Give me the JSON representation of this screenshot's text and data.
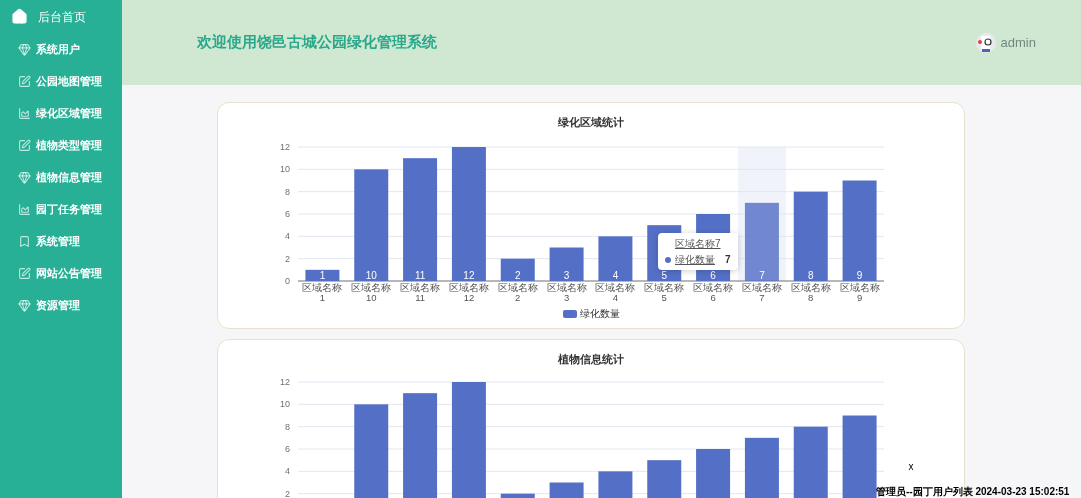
{
  "sidebar": {
    "home": "后台首页",
    "items": [
      {
        "label": "系统用户",
        "kind": "gem"
      },
      {
        "label": "公园地图管理",
        "kind": "edit"
      },
      {
        "label": "绿化区域管理",
        "kind": "chart"
      },
      {
        "label": "植物类型管理",
        "kind": "edit"
      },
      {
        "label": "植物信息管理",
        "kind": "gem"
      },
      {
        "label": "园丁任务管理",
        "kind": "chart"
      },
      {
        "label": "系统管理",
        "kind": "bookmark"
      },
      {
        "label": "网站公告管理",
        "kind": "edit"
      },
      {
        "label": "资源管理",
        "kind": "gem"
      }
    ]
  },
  "header": {
    "title": "欢迎使用饶邑古城公园绿化管理系统",
    "user": "admin"
  },
  "charts": [
    {
      "chart_data": {
        "type": "bar",
        "title": "绿化区域统计",
        "categories": [
          "区域名称 1",
          "区域名称 10",
          "区域名称 11",
          "区域名称 12",
          "区域名称 2",
          "区域名称 3",
          "区域名称 4",
          "区域名称 5",
          "区域名称 6",
          "区域名称 7",
          "区域名称 8",
          "区域名称 9"
        ],
        "series": [
          {
            "name": "绿化数量",
            "color": "#5470c6",
            "values": [
              1,
              10,
              11,
              12,
              2,
              3,
              4,
              5,
              6,
              7,
              8,
              9
            ]
          }
        ],
        "yticks": [
          0,
          2,
          4,
          6,
          8,
          10,
          12
        ],
        "ylim": [
          0,
          12
        ],
        "grid": true,
        "data_labels": true
      },
      "hover": [
        false,
        false,
        false,
        false,
        false,
        false,
        false,
        false,
        false,
        true,
        false,
        false
      ],
      "tooltip": {
        "title": "区域名称7",
        "series": "绿化数量",
        "value": "7"
      }
    },
    {
      "chart_data": {
        "type": "bar",
        "title": "植物信息统计",
        "series": [
          {
            "color": "#5470c6",
            "values": [
              null,
              10,
              11,
              12,
              2,
              3,
              4,
              5,
              6,
              7,
              8,
              9
            ]
          }
        ],
        "yticks": [
          2,
          4,
          6,
          8,
          10,
          12
        ],
        "ylim": [
          0,
          12
        ],
        "grid": true
      }
    }
  ],
  "popup": {
    "close": "x",
    "caption": "管理员--园丁用户列表 2024-03-23 15:02:51"
  }
}
